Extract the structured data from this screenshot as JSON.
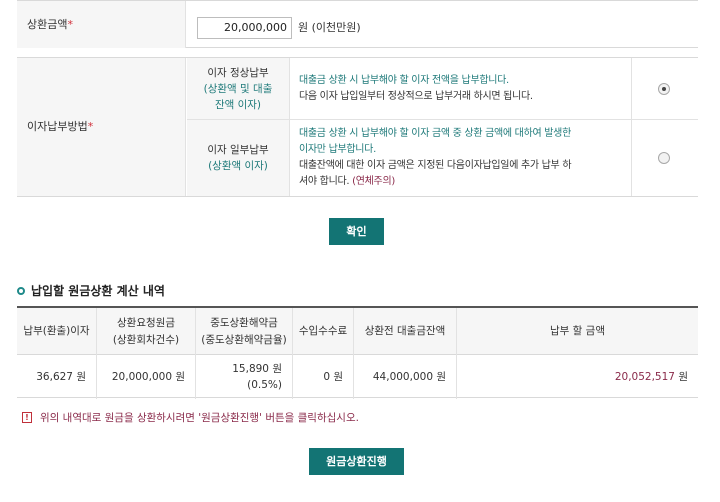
{
  "repayment": {
    "label": "상환금액",
    "required_mark": "*",
    "amount_value": "20,000,000",
    "amount_unit": "원 (이천만원)"
  },
  "interest_method": {
    "label": "이자납부방법",
    "required_mark": "*",
    "options": [
      {
        "title_line1": "이자 정상납부",
        "title_line2": "(상환액 및 대출",
        "title_line3": "잔액 이자)",
        "desc_line1": "대출금 상환 시 납부해야 할 이자 전액을 납부합니다.",
        "desc_line2": "다음 이자 납입일부터 정상적으로 납부거래 하시면 됩니다.",
        "selected": true
      },
      {
        "title_line1": "이자 일부납부",
        "title_line2": "(상환액 이자)",
        "desc_line1": "대출금 상환 시 납부해야 할 이자 금액 중 상환 금액에 대하여 발생한",
        "desc_line2": "이자만 납부합니다.",
        "desc_line3": "대출잔액에 대한 이자 금액은 지정된 다음이자납입일에 추가 납부 하",
        "desc_line4": "셔야 합니다.",
        "desc_warn": "(연체주의)",
        "selected": false
      }
    ]
  },
  "confirm_button": "확인",
  "section_title": "납입할 원금상환 계산 내역",
  "result_table": {
    "headers": [
      [
        "납부(환출)이자"
      ],
      [
        "상환요청원금",
        "(상환회차건수)"
      ],
      [
        "중도상환해약금",
        "(중도상환해약금율)"
      ],
      [
        "수입수수료"
      ],
      [
        "상환전 대출금잔액"
      ],
      [
        "납부 할 금액"
      ]
    ],
    "row": {
      "interest": "36,627 원",
      "principal": "20,000,000 원",
      "penalty": "15,890 원",
      "penalty_rate": "(0.5%)",
      "fee": "0 원",
      "balance": "44,000,000 원",
      "total": "20,052,517",
      "total_unit": "원"
    }
  },
  "notice": {
    "icon": "!",
    "text": "위의 내역대로 원금을 상환하시려면 '원금상환진행' 버튼을 클릭하십시오."
  },
  "proceed_button": "원금상환진행",
  "colors": {
    "accent": "#137474",
    "teal_text": "#1f7a7a",
    "plum_text": "#8a2a4a",
    "required": "#d0303a"
  }
}
